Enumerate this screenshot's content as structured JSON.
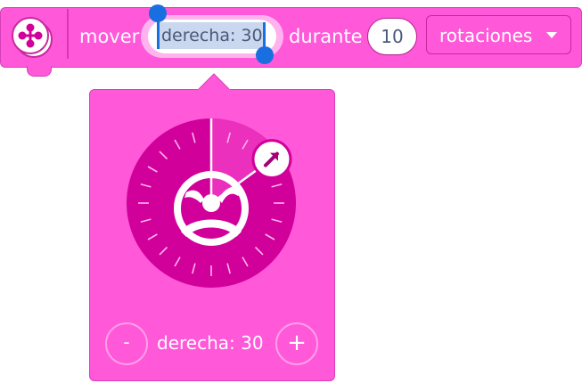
{
  "block": {
    "icon": "drive-base-icon",
    "label_move": "mover",
    "direction_value": "derecha: 30",
    "label_for": "durante",
    "amount_value": "10",
    "unit_selected": "rotaciones",
    "dropdown_icon": "caret-down-icon"
  },
  "popover": {
    "dial_icon": "steering-wheel-icon",
    "handle_icon": "arrow-up-right-icon",
    "steering_level": 30,
    "minus_label": "-",
    "plus_label": "+",
    "value_label": "derecha: 30"
  },
  "colors": {
    "block_fill": "#ff58d9",
    "block_border": "#d63fb9",
    "dial_fill": "#d1009a",
    "selection": "#c9d8ef",
    "caret": "#1a6fe0",
    "text_value": "#4a5a7a"
  }
}
